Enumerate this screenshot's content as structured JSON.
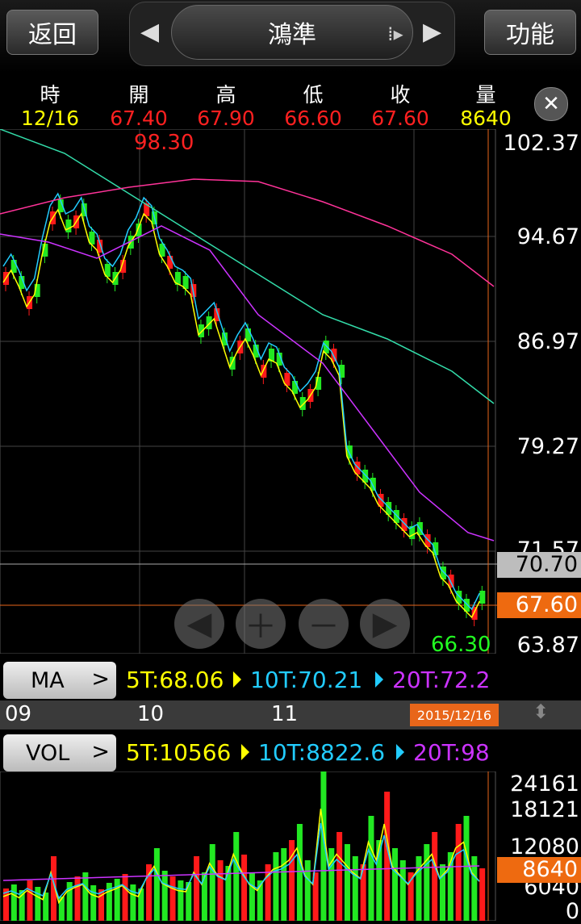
{
  "header": {
    "back_label": "返回",
    "stock_name": "鴻準",
    "function_label": "功能"
  },
  "quote": {
    "columns": [
      {
        "head": "時",
        "value": "12/16",
        "color": "#ffff00"
      },
      {
        "head": "開",
        "value": "67.40",
        "color": "#ff2020"
      },
      {
        "head": "高",
        "value": "67.90",
        "color": "#ff2020"
      },
      {
        "head": "低",
        "value": "66.60",
        "color": "#ff2020"
      },
      {
        "head": "收",
        "value": "67.60",
        "color": "#ff2020"
      },
      {
        "head": "量",
        "value": "8640",
        "color": "#ffff00"
      }
    ]
  },
  "price_chart": {
    "max_label": "98.30",
    "min_label": "66.30",
    "y_ticks": [
      "102.37",
      "94.67",
      "86.97",
      "79.27",
      "71.57",
      "63.87"
    ],
    "ref_price": "70.70",
    "last_price": "67.60",
    "colors": {
      "up": "#ff1a1a",
      "down": "#22e822",
      "ma5": "#ffff00",
      "ma10": "#22ccff",
      "ma20": "#cc33ff",
      "ma60": "#33ddaa",
      "ma120": "#ff3399"
    }
  },
  "ma_row": {
    "button": "MA",
    "chevron": ">",
    "ma5": "5T:68.06",
    "ma10": "10T:70.21",
    "ma20": "20T:72.2"
  },
  "date_axis": {
    "labels": [
      "09",
      "10",
      "11"
    ],
    "current": "2015/12/16"
  },
  "vol_row": {
    "button": "VOL",
    "chevron": ">",
    "v5": "5T:10566",
    "v10": "10T:8822.6",
    "v20": "20T:98"
  },
  "vol_chart": {
    "y_ticks": [
      "24161",
      "18121",
      "12080",
      "6040",
      "0"
    ],
    "last_volume": "8640"
  }
}
